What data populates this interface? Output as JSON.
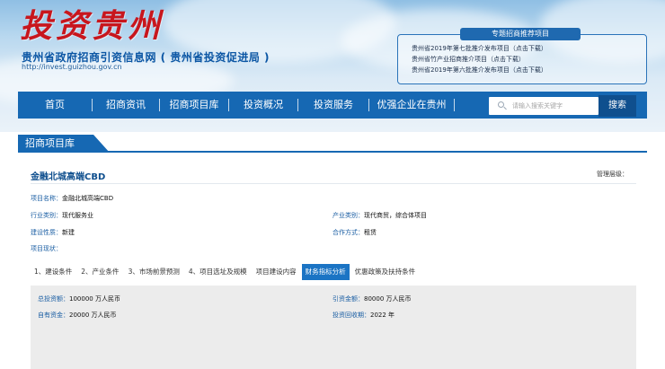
{
  "header": {
    "logo_text": "投资贵州",
    "site_name": "贵州省政府招商引资信息网 ( 贵州省投资促进局 )",
    "site_url": "http://invest.guizhou.gov.cn"
  },
  "featured": {
    "tag": "专题招商推荐项目",
    "items": [
      "贵州省2019年第七批推介发布项目（点击下载）",
      "贵州省竹产业招商推介项目（点击下载）",
      "贵州省2019年第六批推介发布项目（点击下载）"
    ]
  },
  "nav": {
    "items": [
      "首页",
      "招商资讯",
      "招商项目库",
      "投资概况",
      "投资服务",
      "优强企业在贵州"
    ]
  },
  "search": {
    "placeholder": "请输入搜索关键字",
    "button": "搜索"
  },
  "section": {
    "title": "招商项目库"
  },
  "project": {
    "title": "金融北城高端CBD",
    "admin_level_label": "管理层级：",
    "name_label": "项目名称：",
    "name_value": "金融北城高端CBD",
    "industry_label": "行业类别：",
    "industry_value": "现代服务业",
    "product_label": "产业类别：",
    "product_value": "现代商贸，综合体项目",
    "build_label": "建设性质：",
    "build_value": "新建",
    "coop_label": "合作方式：",
    "coop_value": "租赁",
    "status_label": "项目现状："
  },
  "tabs": [
    "1、建设条件",
    "2、产业条件",
    "3、市场前景预测",
    "4、项目选址及规模",
    "项目建设内容",
    "财务指标分析",
    "优惠政策及扶持条件"
  ],
  "active_tab_index": 5,
  "finance": {
    "total_label": "总投资额：",
    "total_value": "100000 万人民币",
    "attract_label": "引资金额：",
    "attract_value": "80000 万人民币",
    "own_label": "自有资金：",
    "own_value": "20000 万人民币",
    "payback_label": "投资回收期：",
    "payback_value": "2022 年"
  },
  "colors": {
    "nav_blue": "#1668b3",
    "logo_red": "#c8161d",
    "label_blue": "#1a5ea3",
    "active_tab": "#1b74c4"
  }
}
